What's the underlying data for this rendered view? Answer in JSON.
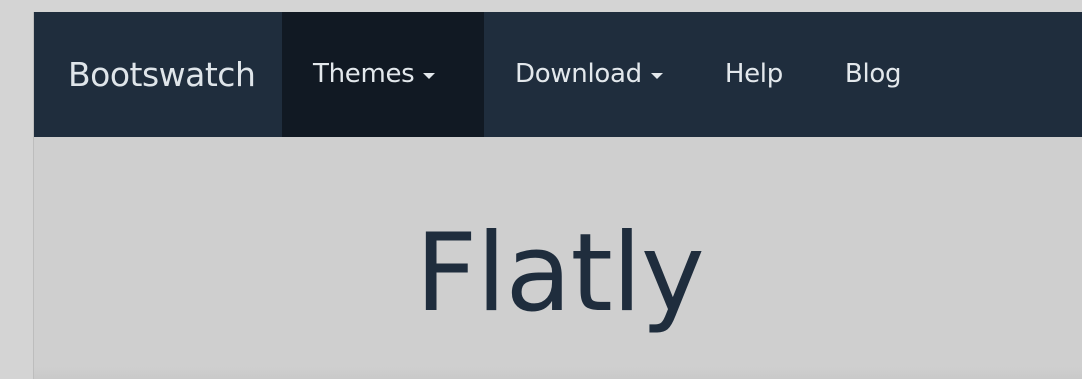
{
  "navbar": {
    "brand": "Bootswatch",
    "items": [
      {
        "label": "Themes",
        "dropdown": true,
        "active": true
      },
      {
        "label": "Download",
        "dropdown": true,
        "active": false
      },
      {
        "label": "Help",
        "dropdown": false,
        "active": false
      },
      {
        "label": "Blog",
        "dropdown": false,
        "active": false
      }
    ]
  },
  "hero": {
    "title": "Flatly"
  },
  "colors": {
    "navbar_bg": "#1f2d3d",
    "navbar_active_bg": "#111923",
    "page_bg": "#cfcfcf",
    "title_color": "#1f2d3d"
  }
}
